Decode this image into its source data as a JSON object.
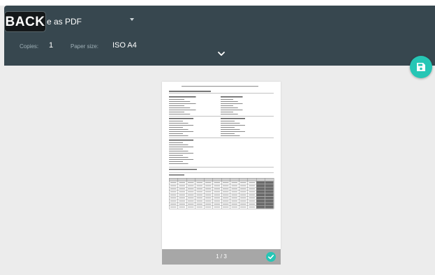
{
  "toolbar": {
    "back_label": "BACK",
    "destination": "e as PDF",
    "copies_label": "Copies:",
    "copies_value": "1",
    "paper_size_label": "Paper size:",
    "paper_size_value": "ISO A4",
    "expand_icon": "chevron-down-icon",
    "save_icon": "save-icon"
  },
  "preview": {
    "page_counter": "1 / 3",
    "selected_icon": "check-circle-icon"
  },
  "colors": {
    "toolbar_bg": "#37474f",
    "accent": "#26c6b5",
    "background": "#ececec"
  }
}
